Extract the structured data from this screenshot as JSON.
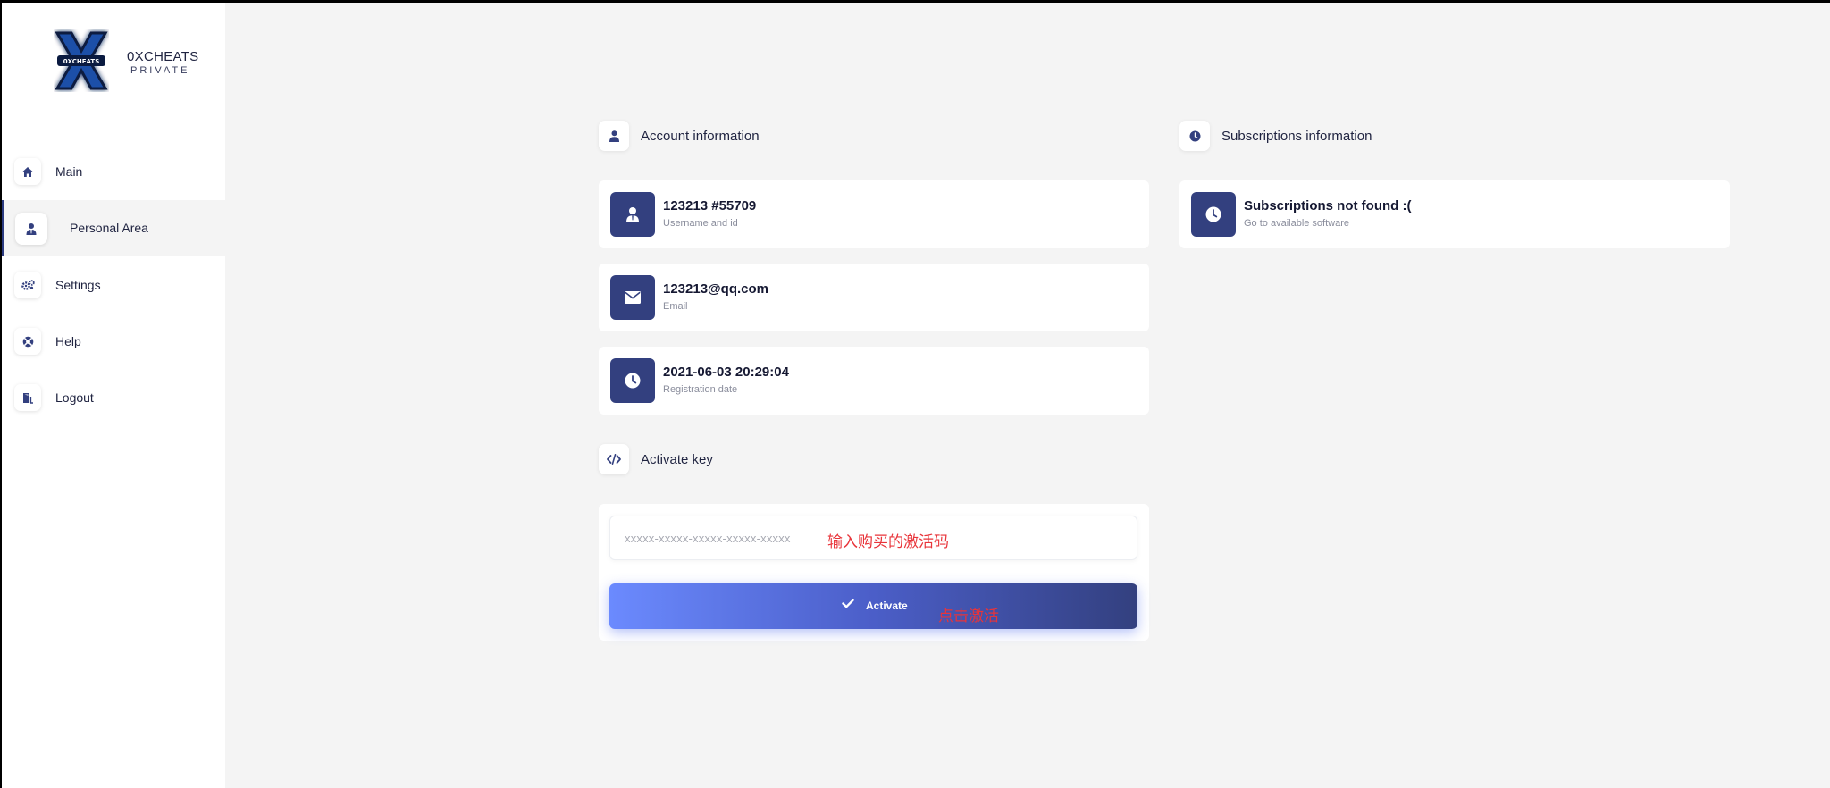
{
  "brand": {
    "name": "0XCHEATS",
    "tagline": "PRIVATE",
    "logo_text": "0XCHEATS"
  },
  "sidebar": {
    "items": [
      {
        "label": "Main",
        "icon": "home-icon"
      },
      {
        "label": "Personal Area",
        "icon": "user-tie-icon",
        "active": true
      },
      {
        "label": "Settings",
        "icon": "gears-icon"
      },
      {
        "label": "Help",
        "icon": "lifebuoy-icon"
      },
      {
        "label": "Logout",
        "icon": "door-exit-icon"
      }
    ]
  },
  "account": {
    "heading": "Account information",
    "cards": [
      {
        "value": "123213 #55709",
        "label": "Username and id",
        "icon": "user-tie-icon"
      },
      {
        "value": "123213@qq.com",
        "label": "Email",
        "icon": "envelope-icon"
      },
      {
        "value": "2021-06-03 20:29:04",
        "label": "Registration date",
        "icon": "clock-icon"
      }
    ]
  },
  "subscriptions": {
    "heading": "Subscriptions information",
    "card": {
      "value": "Subscriptions not found :(",
      "label": "Go to available software",
      "icon": "clock-icon"
    }
  },
  "activate": {
    "heading": "Activate key",
    "input_placeholder": "xxxxx-xxxxx-xxxxx-xxxxx-xxxxx",
    "input_value": "",
    "input_hint": "输入购买的激活码",
    "button_label": "Activate",
    "button_hint": "点击激活"
  },
  "colors": {
    "accent": "#33407f",
    "gradient_start": "#6b8afe",
    "annotation_red": "#e8343a",
    "background": "#f4f4f4"
  }
}
